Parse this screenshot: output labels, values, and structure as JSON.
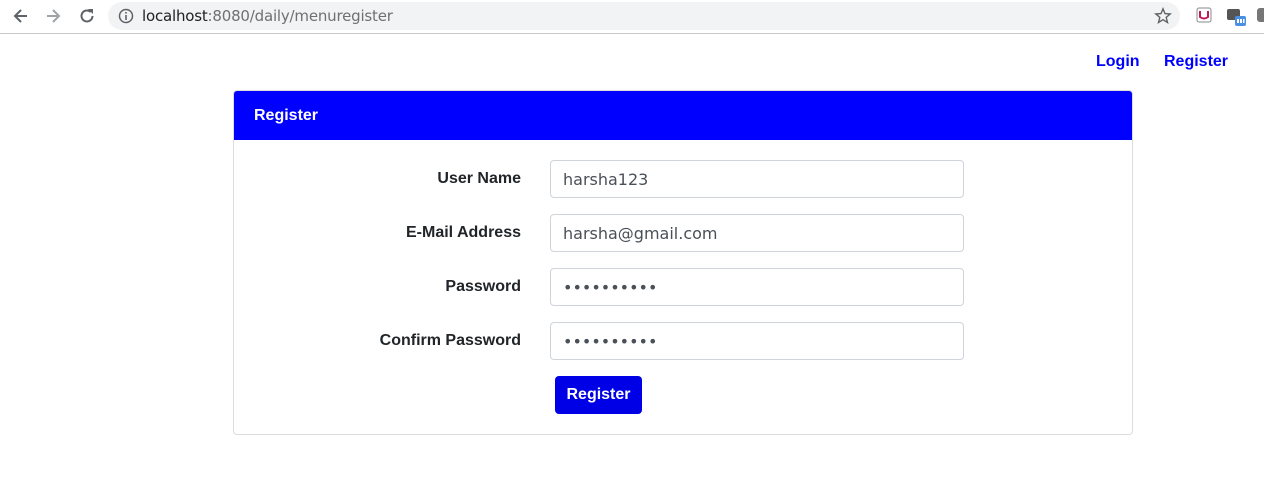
{
  "browser": {
    "url_host": "localhost",
    "url_rest": ":8080/daily/menuregister",
    "icons": [
      "back-arrow-icon",
      "forward-arrow-icon",
      "reload-icon",
      "info-icon",
      "star-icon",
      "extension-icon"
    ]
  },
  "topnav": {
    "login": "Login",
    "register": "Register"
  },
  "card": {
    "header": "Register",
    "fields": [
      {
        "label": "User Name",
        "value": "harsha123",
        "type": "text"
      },
      {
        "label": "E-Mail Address",
        "value": "harsha@gmail.com",
        "type": "email"
      },
      {
        "label": "Password",
        "value": "••••••••••",
        "type": "password"
      },
      {
        "label": "Confirm Password",
        "value": "••••••••••",
        "type": "password"
      }
    ],
    "submit_label": "Register"
  },
  "colors": {
    "primary": "#0000ff",
    "button": "#0000e6",
    "link": "#0000ff"
  }
}
